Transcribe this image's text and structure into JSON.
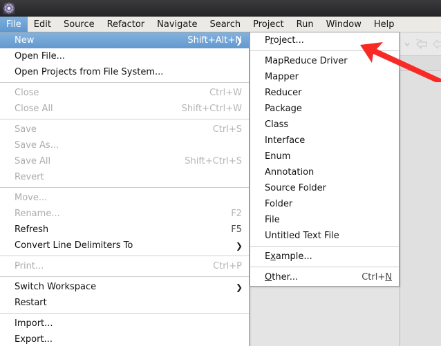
{
  "window": {
    "app_icon": "gear-icon"
  },
  "menubar": {
    "items": [
      {
        "label": "File",
        "active": true
      },
      {
        "label": "Edit",
        "active": false
      },
      {
        "label": "Source",
        "active": false
      },
      {
        "label": "Refactor",
        "active": false
      },
      {
        "label": "Navigate",
        "active": false
      },
      {
        "label": "Search",
        "active": false
      },
      {
        "label": "Project",
        "active": false
      },
      {
        "label": "Run",
        "active": false
      },
      {
        "label": "Window",
        "active": false
      },
      {
        "label": "Help",
        "active": false
      }
    ]
  },
  "file_menu": {
    "items": [
      {
        "label": "New",
        "accel": "Shift+Alt+N",
        "submenu": true,
        "disabled": false,
        "selected": true
      },
      {
        "label": "Open File...",
        "accel": "",
        "submenu": false,
        "disabled": false,
        "selected": false
      },
      {
        "label": "Open Projects from File System...",
        "accel": "",
        "submenu": false,
        "disabled": false,
        "selected": false
      },
      {
        "separator": true
      },
      {
        "label": "Close",
        "accel": "Ctrl+W",
        "submenu": false,
        "disabled": true,
        "selected": false
      },
      {
        "label": "Close All",
        "accel": "Shift+Ctrl+W",
        "submenu": false,
        "disabled": true,
        "selected": false
      },
      {
        "separator": true
      },
      {
        "label": "Save",
        "accel": "Ctrl+S",
        "submenu": false,
        "disabled": true,
        "selected": false
      },
      {
        "label": "Save As...",
        "accel": "",
        "submenu": false,
        "disabled": true,
        "selected": false
      },
      {
        "label": "Save All",
        "accel": "Shift+Ctrl+S",
        "submenu": false,
        "disabled": true,
        "selected": false
      },
      {
        "label": "Revert",
        "accel": "",
        "submenu": false,
        "disabled": true,
        "selected": false
      },
      {
        "separator": true
      },
      {
        "label": "Move...",
        "accel": "",
        "submenu": false,
        "disabled": true,
        "selected": false
      },
      {
        "label": "Rename...",
        "accel": "F2",
        "submenu": false,
        "disabled": true,
        "selected": false
      },
      {
        "label": "Refresh",
        "accel": "F5",
        "submenu": false,
        "disabled": false,
        "selected": false
      },
      {
        "label": "Convert Line Delimiters To",
        "accel": "",
        "submenu": true,
        "disabled": false,
        "selected": false
      },
      {
        "separator": true
      },
      {
        "label": "Print...",
        "accel": "Ctrl+P",
        "submenu": false,
        "disabled": true,
        "selected": false
      },
      {
        "separator": true
      },
      {
        "label": "Switch Workspace",
        "accel": "",
        "submenu": true,
        "disabled": false,
        "selected": false
      },
      {
        "label": "Restart",
        "accel": "",
        "submenu": false,
        "disabled": false,
        "selected": false
      },
      {
        "separator": true
      },
      {
        "label": "Import...",
        "accel": "",
        "submenu": false,
        "disabled": false,
        "selected": false
      },
      {
        "label": "Export...",
        "accel": "",
        "submenu": false,
        "disabled": false,
        "selected": false
      }
    ]
  },
  "new_submenu": {
    "items": [
      {
        "label": "Project...",
        "accel": "",
        "mnemonic_index": 1,
        "disabled": false
      },
      {
        "separator": true
      },
      {
        "label": "MapReduce Driver",
        "accel": "",
        "mnemonic_index": -1,
        "disabled": false
      },
      {
        "label": "Mapper",
        "accel": "",
        "mnemonic_index": -1,
        "disabled": false
      },
      {
        "label": "Reducer",
        "accel": "",
        "mnemonic_index": -1,
        "disabled": false
      },
      {
        "label": "Package",
        "accel": "",
        "mnemonic_index": -1,
        "disabled": false
      },
      {
        "label": "Class",
        "accel": "",
        "mnemonic_index": -1,
        "disabled": false
      },
      {
        "label": "Interface",
        "accel": "",
        "mnemonic_index": -1,
        "disabled": false
      },
      {
        "label": "Enum",
        "accel": "",
        "mnemonic_index": -1,
        "disabled": false
      },
      {
        "label": "Annotation",
        "accel": "",
        "mnemonic_index": -1,
        "disabled": false
      },
      {
        "label": "Source Folder",
        "accel": "",
        "mnemonic_index": -1,
        "disabled": false
      },
      {
        "label": "Folder",
        "accel": "",
        "mnemonic_index": -1,
        "disabled": false
      },
      {
        "label": "File",
        "accel": "",
        "mnemonic_index": -1,
        "disabled": false
      },
      {
        "label": "Untitled Text File",
        "accel": "",
        "mnemonic_index": -1,
        "disabled": false
      },
      {
        "separator": true
      },
      {
        "label": "Example...",
        "accel": "",
        "mnemonic_index": 1,
        "disabled": false
      },
      {
        "separator": true
      },
      {
        "label": "Other...",
        "accel": "Ctrl+N",
        "mnemonic_index": 0,
        "accel_mnemonic_index": 5,
        "disabled": false
      }
    ]
  },
  "annotation": {
    "arrow_color": "#f72a25",
    "points_to": "Project..."
  },
  "colors": {
    "titlebar": "#2f2f31",
    "menubar_bg": "#eceae5",
    "highlight": "#6398ce",
    "menu_bg": "#ffffff",
    "workbench_bg": "#e4e4e4",
    "disabled_text": "#ababab"
  },
  "toolbar": {
    "icons": [
      "dropdown-caret-icon",
      "back-arrow-icon",
      "forward-arrow-icon"
    ]
  }
}
